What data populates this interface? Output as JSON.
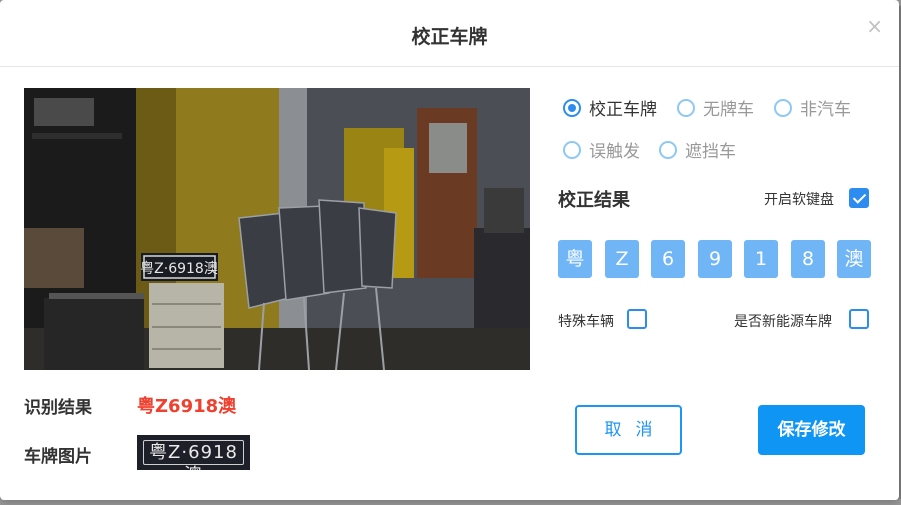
{
  "dialog": {
    "title": "校正车牌",
    "close_symbol": "×"
  },
  "snapshot": {
    "plate_text": "粤Z·6918澳"
  },
  "recognition": {
    "label": "识别结果",
    "value": "粤Z6918澳"
  },
  "plate_image": {
    "label": "车牌图片",
    "text": "粤Z·6918澳"
  },
  "mode_options": [
    {
      "label": "校正车牌",
      "checked": true
    },
    {
      "label": "无牌车",
      "checked": false
    },
    {
      "label": "非汽车",
      "checked": false
    },
    {
      "label": "误触发",
      "checked": false
    },
    {
      "label": "遮挡车",
      "checked": false
    }
  ],
  "correction": {
    "title": "校正结果",
    "soft_keyboard_label": "开启软键盘",
    "soft_keyboard_checked": true,
    "characters": [
      "粤",
      "Z",
      "6",
      "9",
      "1",
      "8",
      "澳"
    ],
    "special_vehicle_label": "特殊车辆",
    "special_vehicle_checked": false,
    "new_energy_label": "是否新能源车牌",
    "new_energy_checked": false
  },
  "buttons": {
    "cancel": "取消",
    "save": "保存修改"
  },
  "colors": {
    "accent": "#2d8cf0",
    "char_box": "#70b6f6",
    "recognition_value": "#f0402f"
  }
}
